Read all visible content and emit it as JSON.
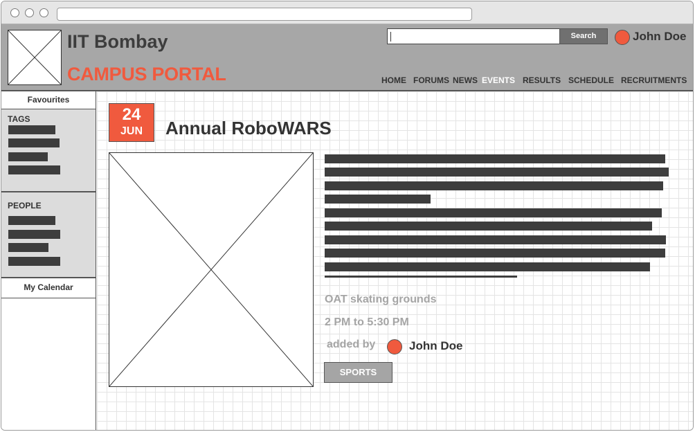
{
  "header": {
    "brand": "IIT Bombay",
    "subtitle": "CAMPUS PORTAL",
    "search_button": "Search",
    "user_name": "John Doe",
    "nav": [
      "HOME",
      "FORUMS",
      "NEWS",
      "EVENTS",
      "RESULTS",
      "SCHEDULE",
      "RECRUITMENTS"
    ],
    "active_nav": "EVENTS"
  },
  "sidebar": {
    "favourites": "Favourites",
    "tags_title": "TAGS",
    "people_title": "PEOPLE",
    "calendar": "My Calendar"
  },
  "event": {
    "day": "24",
    "month": "JUN",
    "title": "Annual RoboWARS",
    "location": "OAT skating grounds",
    "time": "2 PM to 5:30 PM",
    "added_by_label": "added by",
    "added_by_name": "John Doe",
    "tag": "SPORTS"
  },
  "colors": {
    "accent": "#f05a3e",
    "header_bg": "#a7a7a7",
    "text_dark": "#3d3d3d",
    "muted": "#a5a5a5"
  }
}
